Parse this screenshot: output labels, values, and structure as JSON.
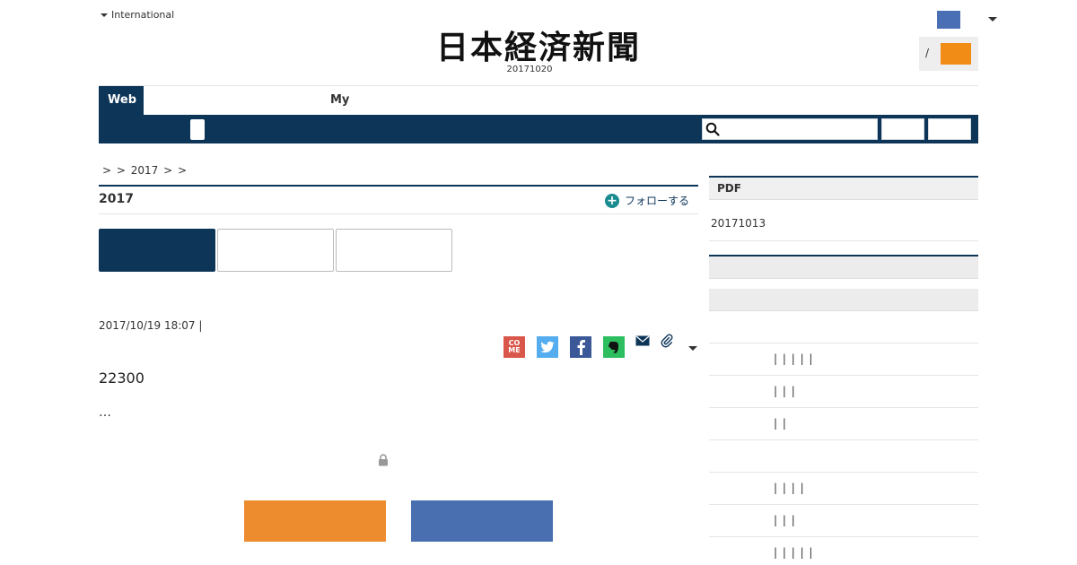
{
  "header": {
    "edition_label": "International",
    "logo_text": "日本経済新聞",
    "paper_date": "20171020",
    "login_separator": "/"
  },
  "nav": {
    "tab_web": "Web",
    "tab_my": "My"
  },
  "breadcrumb": {
    "text": "> > 2017 > >"
  },
  "article": {
    "heading": "2017",
    "follow_label": "フォローする",
    "timestamp": "2017/10/19 18:07 |",
    "lead": "22300",
    "ellipsis": "…",
    "share_comme": "CO ME"
  },
  "sidebar": {
    "pdf_label": "PDF",
    "pdf_date": "20171013",
    "rows": [
      "| | | | |",
      "| | |",
      "| |",
      "",
      "| | | |",
      "| | |",
      "| | | | |"
    ]
  },
  "colors": {
    "navy": "#0d3558",
    "orange": "#ed8b2f",
    "blue": "#4a6fb0"
  }
}
